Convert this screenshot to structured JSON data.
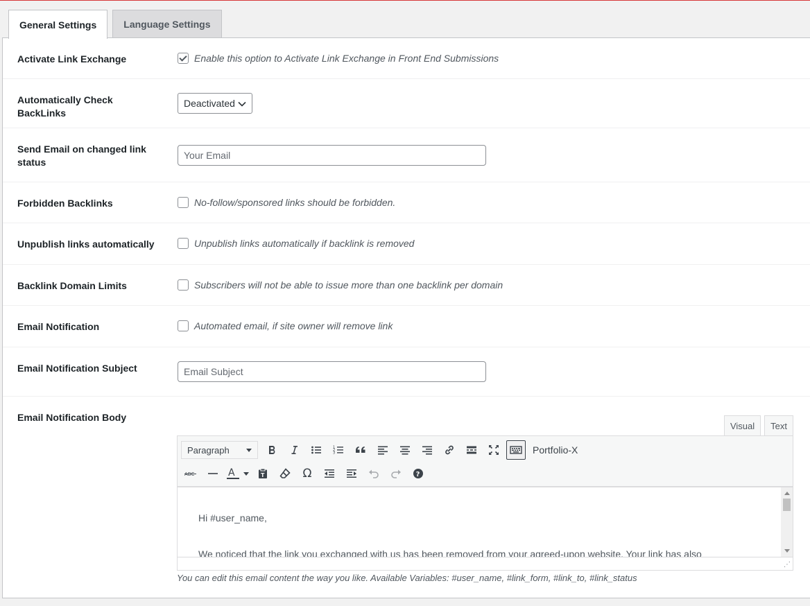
{
  "tabs": [
    {
      "label": "General Settings",
      "active": true
    },
    {
      "label": "Language Settings",
      "active": false
    }
  ],
  "settings": {
    "activate_link_exchange": {
      "label": "Activate Link Exchange",
      "checked": true,
      "description": "Enable this option to Activate Link Exchange in Front End Submissions"
    },
    "auto_check_backlinks": {
      "label": "Automatically Check BackLinks",
      "selected": "Deactivated"
    },
    "send_email_changed_status": {
      "label": "Send Email on changed link status",
      "placeholder": "Your Email",
      "value": ""
    },
    "forbidden_backlinks": {
      "label": "Forbidden Backlinks",
      "checked": false,
      "description": "No-follow/sponsored links should be forbidden."
    },
    "unpublish_links": {
      "label": "Unpublish links automatically",
      "checked": false,
      "description": "Unpublish links automatically if backlink is removed"
    },
    "backlink_domain_limits": {
      "label": "Backlink Domain Limits",
      "checked": false,
      "description": "Subscribers will not be able to issue more than one backlink per domain"
    },
    "email_notification": {
      "label": "Email Notification",
      "checked": false,
      "description": "Automated email, if site owner will remove link"
    },
    "email_notification_subject": {
      "label": "Email Notification Subject",
      "placeholder": "Email Subject",
      "value": ""
    },
    "email_notification_body": {
      "label": "Email Notification Body"
    }
  },
  "editor": {
    "tabs": [
      {
        "label": "Visual",
        "active": true
      },
      {
        "label": "Text",
        "active": false
      }
    ],
    "format_selected": "Paragraph",
    "toolbar_text": "Portfolio-X",
    "toolbar_icons_row1": [
      "bold-icon",
      "italic-icon",
      "bulleted-list-icon",
      "numbered-list-icon",
      "blockquote-icon",
      "align-left-icon",
      "align-center-icon",
      "align-right-icon",
      "link-icon",
      "read-more-icon",
      "fullscreen-icon",
      "keyboard-icon"
    ],
    "toolbar_icons_row2": [
      "strikethrough-icon",
      "horizontal-line-icon",
      "text-color-icon",
      "paste-text-icon",
      "clear-formatting-icon",
      "special-character-icon",
      "outdent-icon",
      "indent-icon",
      "undo-icon",
      "redo-icon",
      "help-icon"
    ],
    "content_line1": "Hi #user_name,",
    "content_line2": "We noticed that the link you exchanged with us has been removed from your agreed-upon website. Your link has also"
  },
  "helper_text": "You can edit this email content the way you like. Available Variables: #user_name, #link_form, #link_to, #link_status",
  "colors": {
    "accent_top_line": "#d63638",
    "panel_bg": "#ffffff",
    "page_bg": "#f1f1f1"
  }
}
